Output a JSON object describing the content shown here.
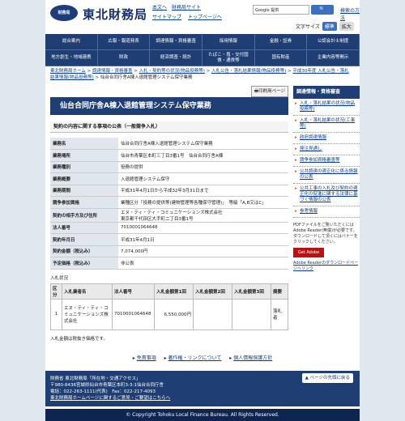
{
  "header": {
    "logo_text": "財務局",
    "site_name": "東北財務局",
    "links": [
      "本文へ",
      "財務局サイト",
      "サイトマップ",
      "トップページへ"
    ],
    "search_placeholder": "Google 提供",
    "search_button": "検索",
    "search_help": "検索の方法",
    "font_size_label": "文字サイズ",
    "font_std": "標準",
    "font_big": "拡大"
  },
  "nav": [
    "総合案内",
    "広報・報道発表",
    "調達情報・資格審査",
    "採用情報",
    "金融・証券",
    "公認会計士制度",
    "地方創生・地域連携",
    "財政",
    "経済調査・統計",
    "たばこ・塩・交付国債・通貨等",
    "国有財産",
    "企業内容等開示"
  ],
  "breadcrumb": {
    "items": [
      "東北財務局ホーム",
      "調達情報・資格審査",
      "入札・契約等の状況(物品役務等)",
      "入札公告・落札結果情報(物品役務等)",
      "平成30年度 入札公告・落札結果情報(物品役務等)"
    ],
    "current": "仙台合同庁舎A棟入退館管理システム保守業務"
  },
  "print_label": "印刷用ページ",
  "page_title": "仙台合同庁舎A棟入退館管理システム保守業務",
  "section_title": "契約の内容に関する事項の公表（一般競争入札）",
  "info_rows": [
    {
      "k": "業務名",
      "v": "仙台合同庁舎A棟入退館管理システム保守業務"
    },
    {
      "k": "業務場所",
      "v": "仙台市青葉区本町三丁目3番1号　仙台合同庁舎A棟"
    },
    {
      "k": "業務種別",
      "v": "役務の提供"
    },
    {
      "k": "業務概要",
      "v": "入退館管理システム保守"
    },
    {
      "k": "業務期間",
      "v": "平成31年4月1日から平成32年3月31日まで"
    },
    {
      "k": "競争参加資格",
      "v": "業種区分「役務の提供等(建物管理等各種保守管理)」　等級「A,B又はC」"
    },
    {
      "k": "契約の相手方及び住所",
      "v": "エヌ・ティ・ティ・コミュニケーションズ株式会社\n東京都千代田区大手町二丁目3番1号"
    },
    {
      "k": "法人番号",
      "v": "7010001064648"
    },
    {
      "k": "契約年月日",
      "v": "平成31年4月1日"
    },
    {
      "k": "契約金額（税込み）",
      "v": "7,074,000円"
    },
    {
      "k": "予定価格（税込み）",
      "v": "非公表"
    }
  ],
  "bid": {
    "label": "入札状況",
    "headers": [
      "区分",
      "入札業者名",
      "法人番号",
      "入札金額第1回",
      "入札金額第2回",
      "入札金額第3回",
      "摘要"
    ],
    "rows": [
      [
        "1",
        "エヌ・ティ・ティ・コミュニケーションズ株式会社",
        "7010001064648",
        "6,550,000円",
        "",
        "",
        "落札者"
      ]
    ],
    "note": "入札金額は税抜き価格です。"
  },
  "sidebar": {
    "head": "調達情報・資格審査",
    "items": [
      "入札・落札結果の状況(物品役務等)",
      "入札・落札結果の状況(工事等)",
      "政府調達情報",
      "発注見通し",
      "競争参加資格審査等",
      "公共調達の適正化に係る情報の公表",
      "公共工事の入札及び契約の適正化の促進に関する法律に基づく情報の公表",
      "参考情報"
    ],
    "pdf_note": "PDFファイルをご覧いただくにはAdobe Reader(無償)が必要です。ダウンロードして頂くにはバナーをクリックしてください。",
    "adobe_label": "Get Adobe Reader",
    "download_label": "Adobe Readerのダウンロードページへリンク"
  },
  "footer": {
    "links": [
      "免責事項",
      "著作権・リンクについて",
      "個人情報保護方針"
    ],
    "lines": [
      "財務省 東北財務局「所在地・交通アクセス」",
      "〒980-8436宮城県仙台市青葉区本町3-3-1仙台合同庁舎",
      "電話：022-263-1111(代表)　Fax：022-217-4093",
      "東北財務局ホームページに関するご意見・ご要望はこちらへ"
    ],
    "pagetop": "ページの先頭に戻る",
    "copyright": "© Copyright Tohoku Local Finance Bureau. All Rights Reserved."
  }
}
